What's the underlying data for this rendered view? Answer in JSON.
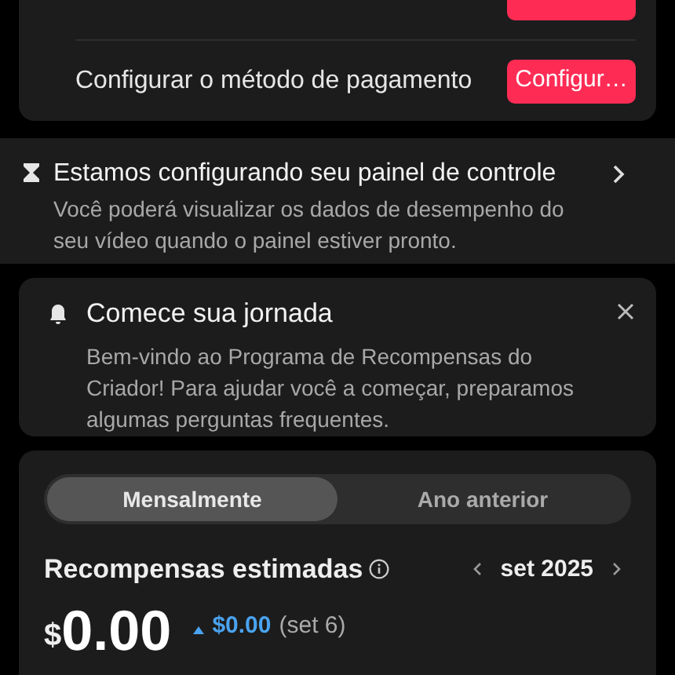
{
  "setup_card": {
    "row_above_cut_off": true
  },
  "setup_tasks": [
    {
      "label": "Configurar o método de pagamento",
      "action": "Configur…"
    }
  ],
  "dashboard_notice": {
    "title": "Estamos configurando seu painel de controle",
    "text": "Você poderá visualizar os dados de desempenho do seu vídeo quando o painel estiver pronto."
  },
  "welcome_card": {
    "title": "Comece sua jornada",
    "text": "Bem-vindo ao Programa de Recompensas do Criador! Para ajudar você a começar, preparamos algumas perguntas frequentes."
  },
  "rewards": {
    "tabs": [
      {
        "label": "Mensalmente",
        "selected": true
      },
      {
        "label": "Ano anterior",
        "selected": false
      }
    ],
    "title": "Recompensas estimadas",
    "period": "set 2025",
    "currency": "$",
    "amount": "0.00",
    "change": "$0.00",
    "change_date": "(set 6)"
  }
}
